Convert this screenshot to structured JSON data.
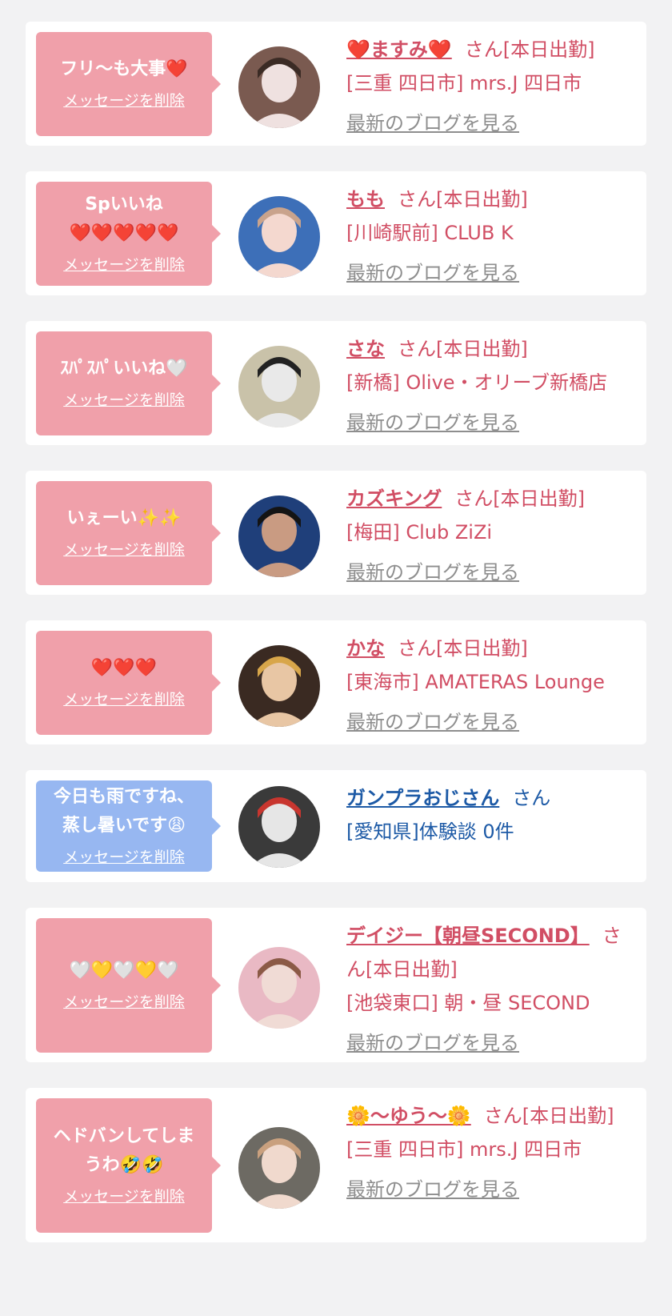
{
  "delete_label": "メッセージを削除",
  "blog_label": "最新のブログを見る",
  "colors": {
    "page_bg": "#f2f2f3",
    "pink_bubble": "#f0a0aa",
    "blue_bubble": "#97b7f1",
    "pink_text": "#d14e64",
    "blue_text": "#1d5aa6",
    "blog_link": "#8e8e8e"
  },
  "messages": [
    {
      "message": "フリ〜も大事❤️",
      "name": "❤️ますみ❤️",
      "suffix": "さん[本日出勤]",
      "shop": "[三重 四日市] mrs.J 四日市",
      "has_blog": true,
      "theme": "pink",
      "avatar_icon": "avatar-woman-cat-ears-icon"
    },
    {
      "message": "Spいいね\n❤️❤️❤️❤️❤️",
      "name": "もも",
      "suffix": "さん[本日出勤]",
      "shop": "[川崎駅前] CLUB K",
      "has_blog": true,
      "theme": "pink",
      "avatar_icon": "avatar-woman-icon"
    },
    {
      "message": "ｽﾊﾟｽﾊﾟいいね🤍",
      "name": "さな",
      "suffix": "さん[本日出勤]",
      "shop": "[新橋] Olive・オリーブ新橋店",
      "has_blog": true,
      "theme": "pink",
      "avatar_icon": "avatar-woman-hidden-face-icon"
    },
    {
      "message": "いぇーい✨✨",
      "name": "カズキング",
      "suffix": "さん[本日出勤]",
      "shop": "[梅田] Club ZiZi",
      "has_blog": true,
      "theme": "pink",
      "avatar_icon": "avatar-man-icon"
    },
    {
      "message": "❤️❤️❤️",
      "name": "かな",
      "suffix": "さん[本日出勤]",
      "shop": "[東海市] AMATERAS Lounge",
      "has_blog": true,
      "theme": "pink",
      "avatar_icon": "avatar-woman-blonde-icon"
    },
    {
      "message": "今日も雨ですね、\n蒸し暑いです😩",
      "name": "ガンプラおじさん",
      "suffix": "さん",
      "shop": "[愛知県]体験談 0件",
      "has_blog": false,
      "theme": "blue",
      "avatar_icon": "avatar-robot-model-icon"
    },
    {
      "message": "🤍💛🤍💛🤍",
      "name": "デイジー【朝昼SECOND】",
      "suffix": "さん[本日出勤]",
      "shop": "[池袋東口] 朝・昼 SECOND",
      "has_blog": true,
      "theme": "pink",
      "avatar_icon": "avatar-woman-striped-bg-icon"
    },
    {
      "message": "ヘドバンしてしま\nうわ🤣🤣",
      "name": "🌼〜ゆう〜🌼",
      "suffix": "さん[本日出勤]",
      "shop": "[三重 四日市] mrs.J 四日市",
      "has_blog": true,
      "theme": "pink",
      "avatar_icon": "avatar-woman-car-icon"
    }
  ]
}
